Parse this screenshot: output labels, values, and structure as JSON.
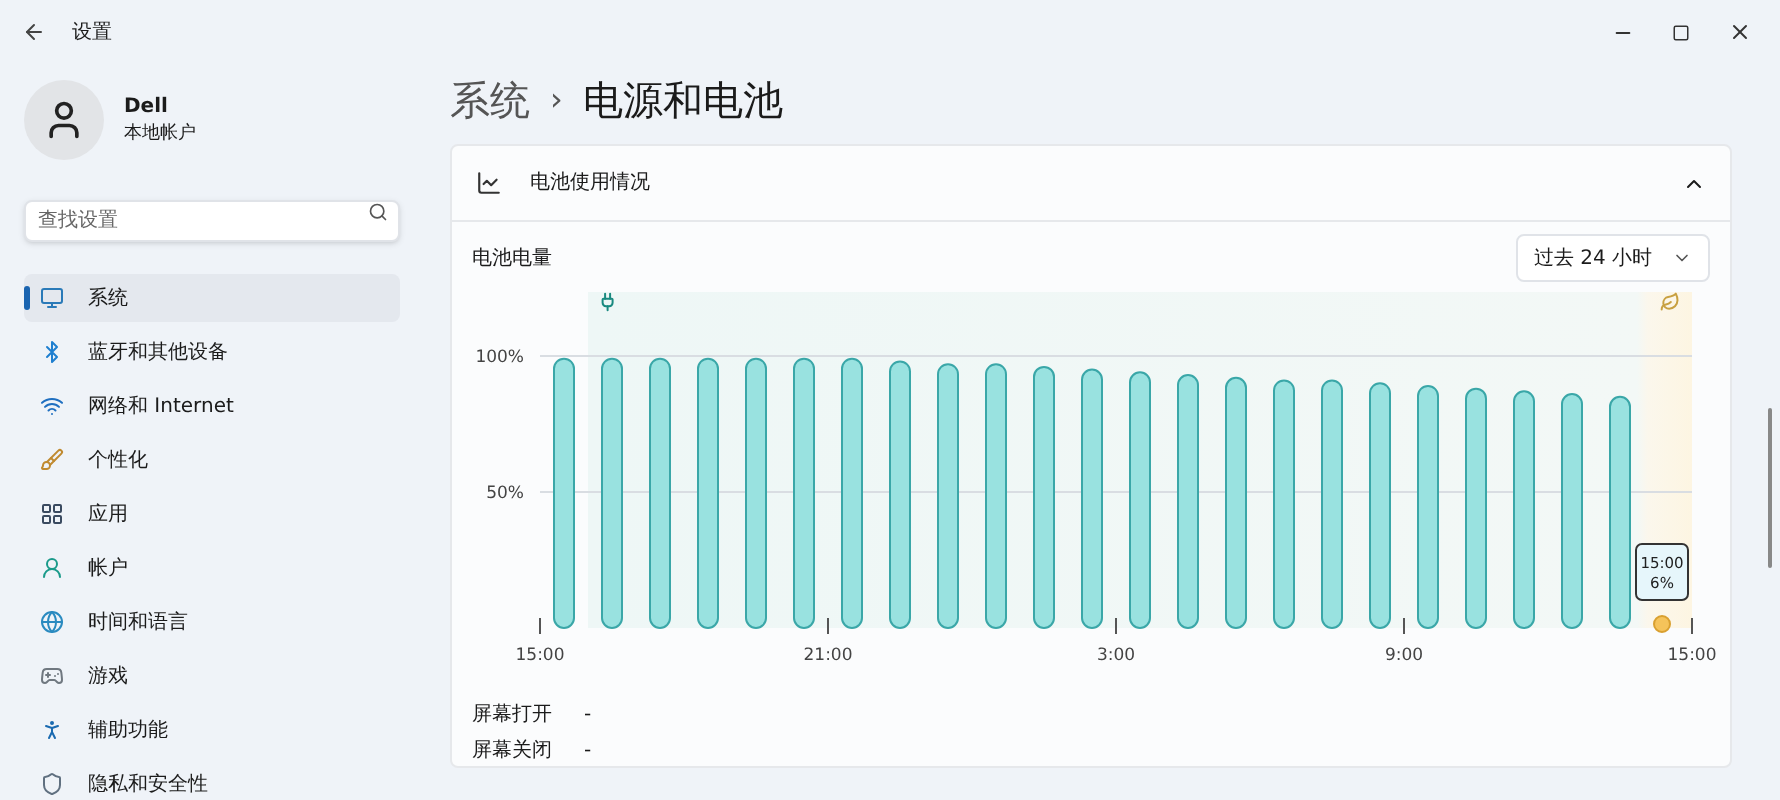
{
  "window": {
    "title": "设置"
  },
  "account": {
    "name": "Dell",
    "type": "本地帐户"
  },
  "search": {
    "placeholder": "查找设置"
  },
  "sidebar": {
    "items": [
      {
        "label": "系统",
        "selected": true
      },
      {
        "label": "蓝牙和其他设备",
        "selected": false
      },
      {
        "label": "网络和 Internet",
        "selected": false
      },
      {
        "label": "个性化",
        "selected": false
      },
      {
        "label": "应用",
        "selected": false
      },
      {
        "label": "帐户",
        "selected": false
      },
      {
        "label": "时间和语言",
        "selected": false
      },
      {
        "label": "游戏",
        "selected": false
      },
      {
        "label": "辅助功能",
        "selected": false
      },
      {
        "label": "隐私和安全性",
        "selected": false
      }
    ]
  },
  "breadcrumb": {
    "parent": "系统",
    "separator": "›",
    "current": "电源和电池"
  },
  "battery_usage": {
    "title": "电池使用情况",
    "expanded": true,
    "level_label": "电池电量",
    "range": "过去 24 小时",
    "chart_data": {
      "type": "bar",
      "categories": [
        "15:00",
        null,
        null,
        null,
        null,
        null,
        "21:00",
        null,
        null,
        null,
        null,
        null,
        "3:00",
        null,
        null,
        null,
        null,
        null,
        "9:00",
        null,
        null,
        null,
        null,
        null,
        "15:00"
      ],
      "values": [
        99,
        99,
        99,
        99,
        99,
        99,
        99,
        98,
        97,
        97,
        96,
        95,
        94,
        93,
        92,
        91,
        91,
        90,
        89,
        88,
        87,
        86,
        85,
        null,
        null
      ],
      "ylim": [
        0,
        100
      ],
      "yticks": [
        {
          "value": 50,
          "label": "50%"
        },
        {
          "value": 100,
          "label": "100%"
        }
      ],
      "annotations": [
        {
          "text": "15:00"
        },
        {
          "text": "6%"
        }
      ]
    },
    "rows": [
      {
        "label": "屏幕打开",
        "value": "-"
      },
      {
        "label": "屏幕关闭",
        "value": "-"
      }
    ]
  }
}
